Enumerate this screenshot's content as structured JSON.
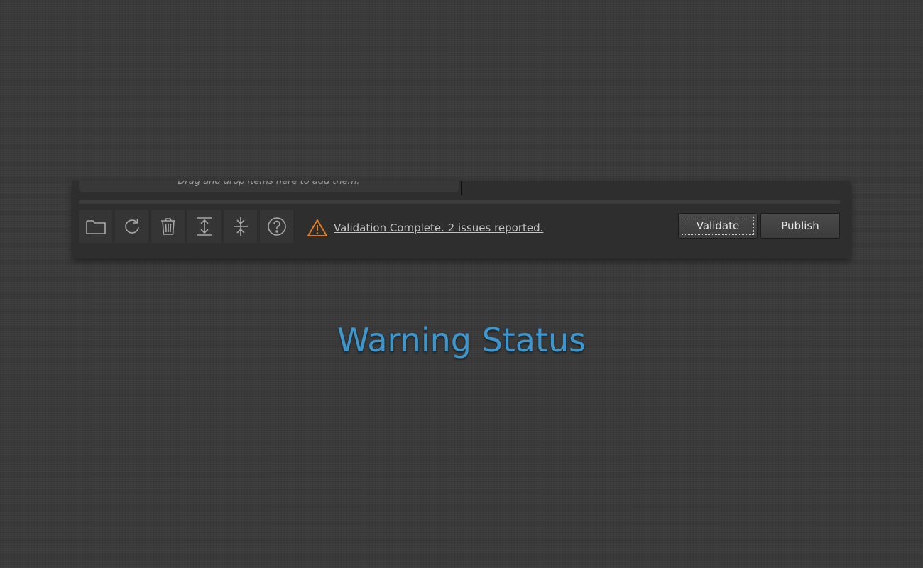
{
  "dropzone": {
    "hint": "Drag and drop items here to add them."
  },
  "toolbar": {
    "icons": [
      "folder-icon",
      "refresh-icon",
      "trash-icon",
      "expand-icon",
      "collapse-icon",
      "help-icon"
    ]
  },
  "status": {
    "icon": "warning-icon",
    "text": "Validation Complete. 2 issues reported.",
    "color": "#e07b20"
  },
  "actions": {
    "validate_label": "Validate",
    "publish_label": "Publish"
  },
  "caption": {
    "title": "Warning Status",
    "color": "#3d97cf"
  }
}
